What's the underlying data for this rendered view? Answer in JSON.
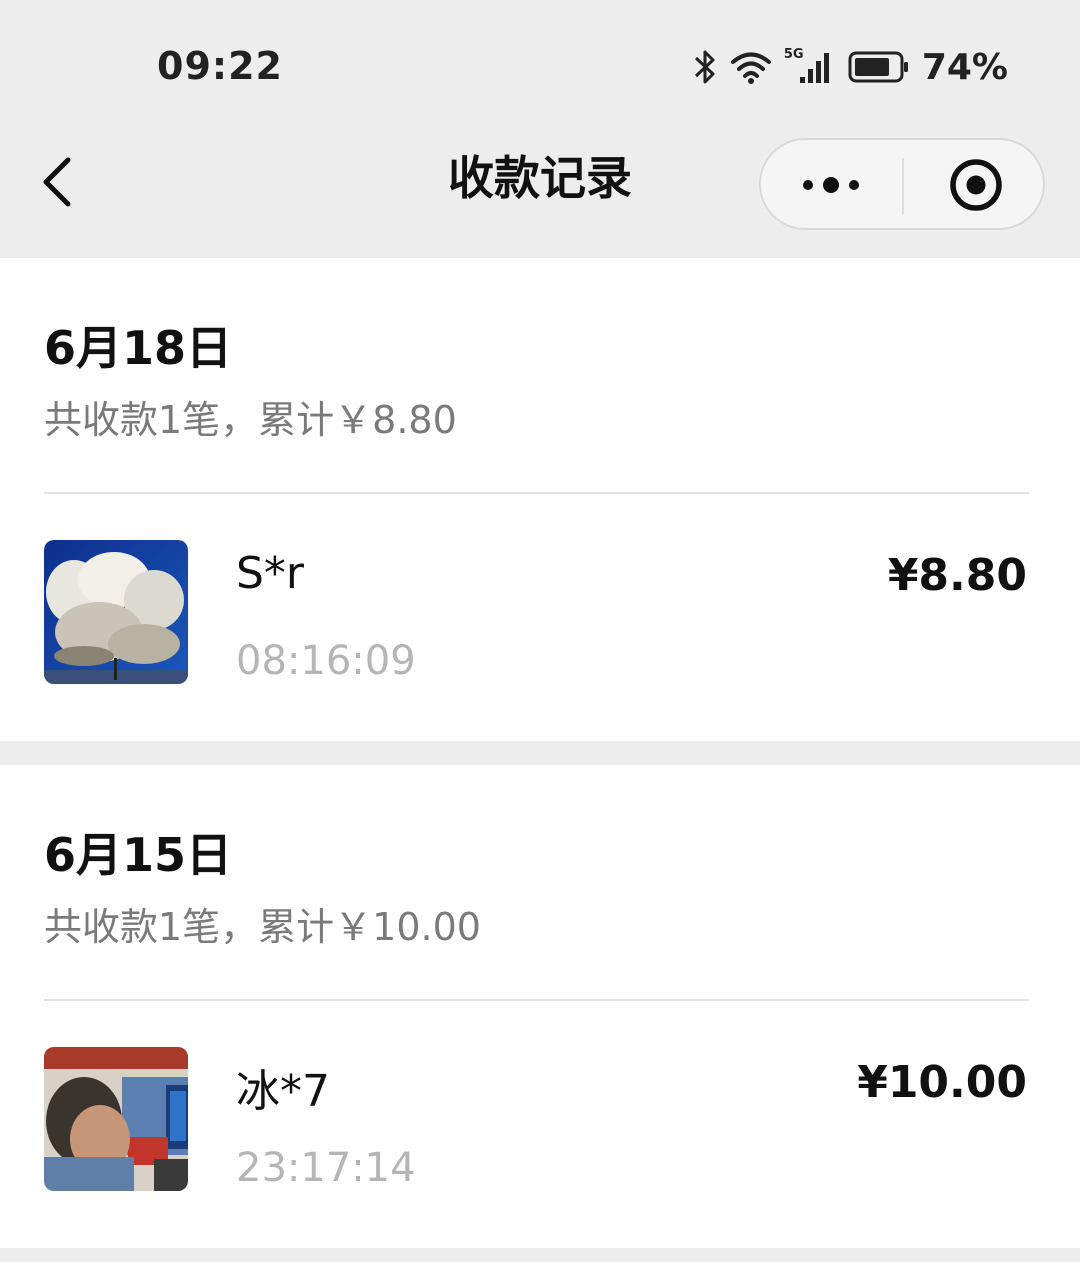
{
  "status_bar": {
    "time": "09:22",
    "network": "5G",
    "battery_percent": "74%",
    "icons": [
      "bluetooth-icon",
      "wifi-icon",
      "cellular-signal-icon",
      "battery-icon"
    ]
  },
  "nav": {
    "title": "收款记录",
    "back_icon": "chevron-left-icon",
    "more_icon": "more-dots-icon",
    "close_icon": "target-circle-icon"
  },
  "groups": [
    {
      "date": "6月18日",
      "summary": "共收款1笔，累计￥8.80",
      "records": [
        {
          "name": "S*r",
          "time": "08:16:09",
          "amount": "¥8.80",
          "avatar": "clouds-photo"
        }
      ]
    },
    {
      "date": "6月15日",
      "summary": "共收款1笔，累计￥10.00",
      "records": [
        {
          "name": "冰*7",
          "time": "23:17:14",
          "amount": "¥10.00",
          "avatar": "person-at-desk-photo"
        }
      ]
    }
  ],
  "colors": {
    "page_bg": "#ededed",
    "card_bg": "#ffffff",
    "primary_text": "#111111",
    "secondary_text": "#7a7a7a",
    "time_text": "#b5b5b5"
  }
}
